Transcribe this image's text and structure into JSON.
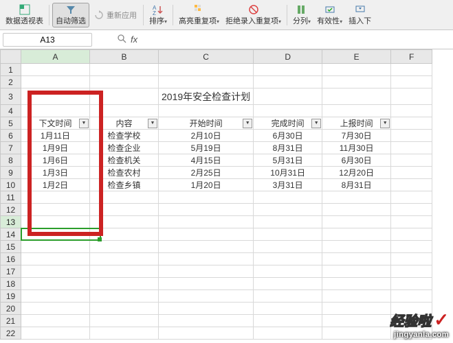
{
  "toolbar": {
    "pivot": "数据透视表",
    "autofilter": "自动筛选",
    "reapply": "重新应用",
    "sort": "排序",
    "highlight_dup": "高亮重复项",
    "reject_dup": "拒绝录入重复项",
    "split_cols": "分列",
    "validity": "有效性",
    "insert": "插入下"
  },
  "namebox": "A13",
  "fx": "fx",
  "columns": [
    "A",
    "B",
    "C",
    "D",
    "E",
    "F"
  ],
  "title": "2019年安全检查计划",
  "headers": {
    "c0": "下文时间",
    "c1": "内容",
    "c2": "开始时间",
    "c3": "完成时间",
    "c4": "上报时间"
  },
  "rows": [
    {
      "c0": "1月11日",
      "c1": "检查学校",
      "c2": "2月10日",
      "c3": "6月30日",
      "c4": "7月30日"
    },
    {
      "c0": "1月9日",
      "c1": "检查企业",
      "c2": "5月19日",
      "c3": "8月31日",
      "c4": "11月30日"
    },
    {
      "c0": "1月6日",
      "c1": "检查机关",
      "c2": "4月15日",
      "c3": "5月31日",
      "c4": "6月30日"
    },
    {
      "c0": "1月3日",
      "c1": "检查农村",
      "c2": "2月25日",
      "c3": "10月31日",
      "c4": "12月20日"
    },
    {
      "c0": "1月2日",
      "c1": "检查乡镇",
      "c2": "1月20日",
      "c3": "3月31日",
      "c4": "8月31日"
    }
  ],
  "watermark": {
    "brand": "经验啦",
    "url": "jingyanla.com"
  }
}
